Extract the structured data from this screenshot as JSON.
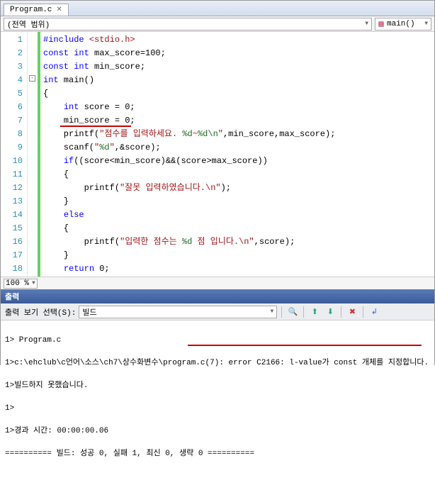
{
  "tab": {
    "title": "Program.c"
  },
  "nav": {
    "scope": "(전역 범위)",
    "func": "main()"
  },
  "gutter": {
    "lines": [
      "1",
      "2",
      "3",
      "4",
      "5",
      "6",
      "7",
      "8",
      "9",
      "10",
      "11",
      "12",
      "13",
      "14",
      "15",
      "16",
      "17",
      "18"
    ]
  },
  "code": {
    "l1_kw": "#include",
    "l1_inc": " <stdio.h>",
    "l2_kw": "const int",
    "l2_rest": " max_score=100;",
    "l3_kw": "const int",
    "l3_rest": " min_score;",
    "l4_kw": "int",
    "l4_rest": " main()",
    "l5": "{",
    "l6a": "    ",
    "l6_kw": "int",
    "l6b": " score = 0;",
    "l7": "    min_score = 0;",
    "l8a": "    printf(",
    "l8s1": "\"점수를 입력하세요. ",
    "l8f1": "%d",
    "l8s2": "~",
    "l8f2": "%d\\n",
    "l8s3": "\"",
    "l8b": ",min_score,max_score);",
    "l9a": "    scanf(",
    "l9s1": "\"",
    "l9f1": "%d",
    "l9s2": "\"",
    "l9b": ",&score);",
    "l10a": "    ",
    "l10_kw": "if",
    "l10b": "((score<min_score)&&(score>max_score))",
    "l11": "    {",
    "l12a": "        printf(",
    "l12s": "\"잘못 입력하였습니다.\\n\"",
    "l12b": ");",
    "l13": "    }",
    "l14a": "    ",
    "l14_kw": "else",
    "l15": "    {",
    "l16a": "        printf(",
    "l16s1": "\"입력한 점수는 ",
    "l16f1": "%d",
    "l16s2": " 점 입니다.\\n\"",
    "l16b": ",score);",
    "l17": "    }",
    "l18a": "    ",
    "l18_kw": "return",
    "l18b": " 0;"
  },
  "zoom": {
    "value": "100 %"
  },
  "output": {
    "header": "출력",
    "label": "출력 보기 선택(S):",
    "select": "빌드",
    "lines": {
      "l1": "1> Program.c",
      "l2a": "1>c:\\ehclub\\c언어\\소스\\ch7\\상수화변수\\program.c(7): ",
      "l2b": "error C2166: l-value가 const 개체를 지정합니다.",
      "l3": "1>빌드하지 못했습니다.",
      "l4": "1>",
      "l5": "1>경과 시간: 00:00:00.06",
      "l6": "========== 빌드: 성공 0, 실패 1, 최신 0, 생략 0 =========="
    }
  }
}
